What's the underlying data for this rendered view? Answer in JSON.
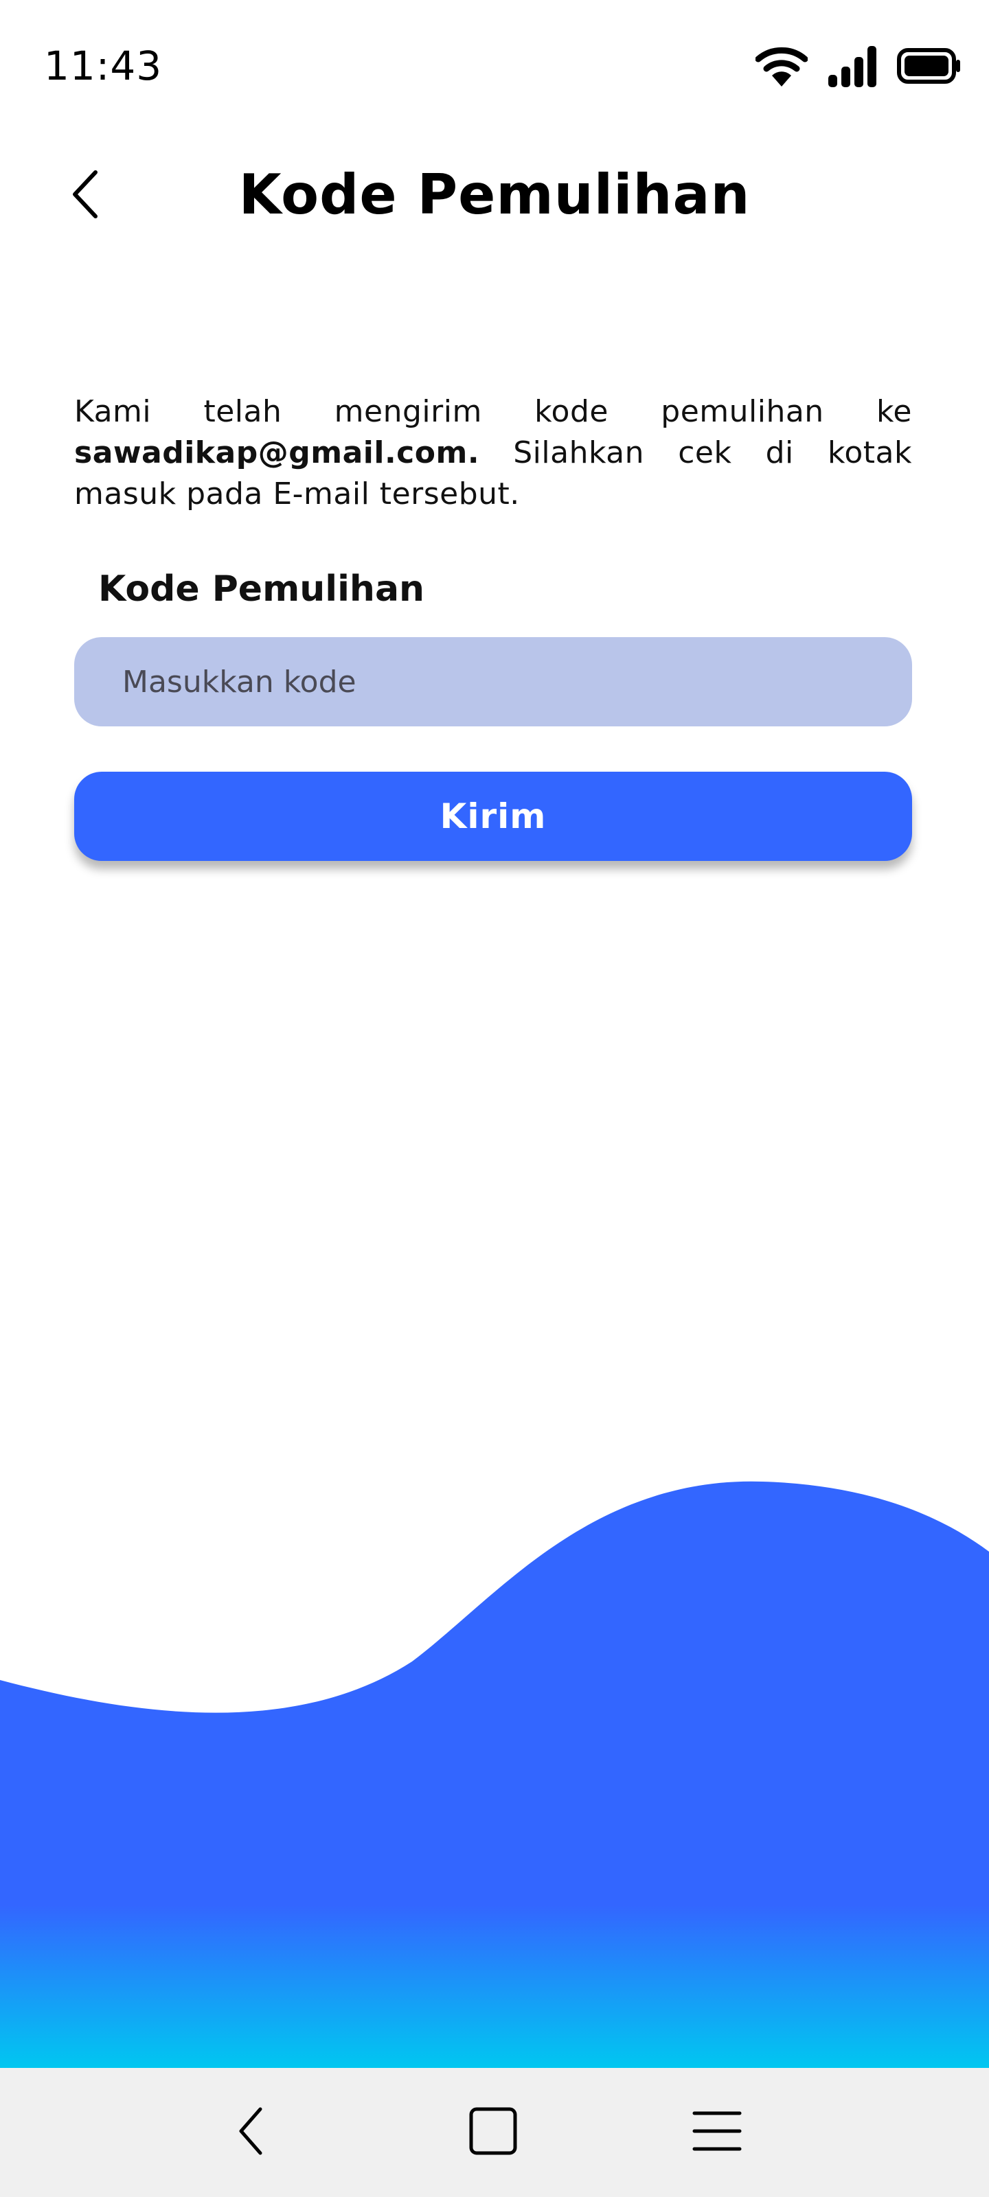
{
  "status_bar": {
    "time": "11:43",
    "icons": [
      "wifi-icon",
      "signal-icon",
      "battery-icon"
    ]
  },
  "header": {
    "title": "Kode Pemulihan",
    "back_icon": "chevron-left-icon"
  },
  "instruction": {
    "text_before": "Kami telah mengirim kode  pemulihan ke ",
    "email": "sawadikap@gmail.com.",
    "text_after": " Silahkan cek di kotak masuk pada E-mail tersebut."
  },
  "form": {
    "code_label": "Kode Pemulihan",
    "code_value": "",
    "code_placeholder": "Masukkan kode",
    "submit_label": "Kirim"
  },
  "colors": {
    "primary": "#3366ff",
    "input_background": "#b9c5ea",
    "wave_top": "#3366ff",
    "wave_bottom": "#00c8f0",
    "nav_background": "#f0f0f0"
  },
  "nav_bar": {
    "icons": [
      "back-triangle-icon",
      "home-square-icon",
      "menu-lines-icon"
    ]
  }
}
